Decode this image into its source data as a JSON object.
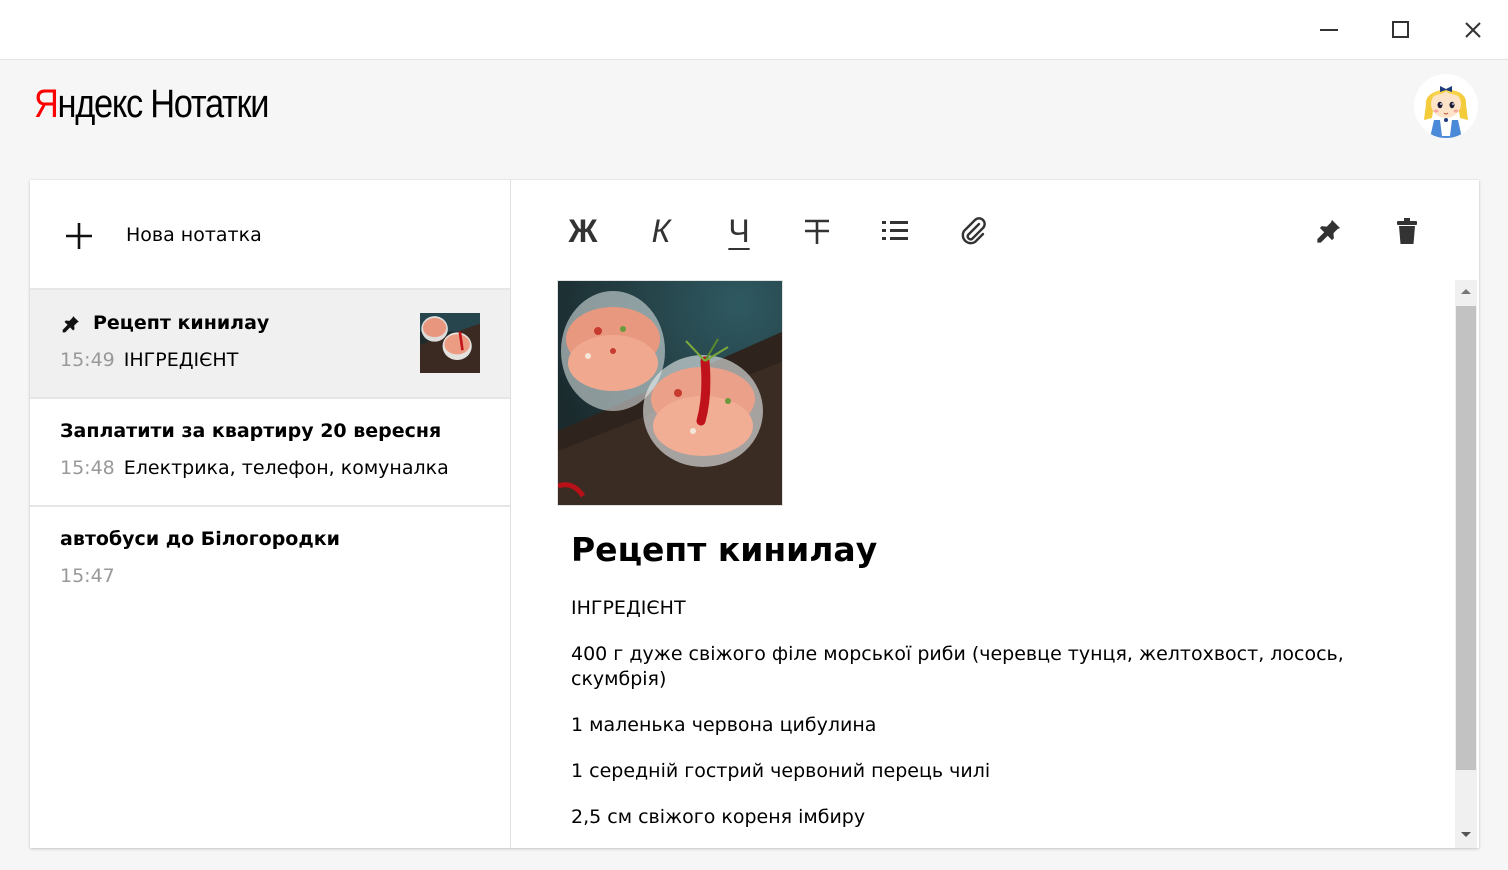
{
  "window": {
    "minimize_icon": "minimize-icon",
    "maximize_icon": "maximize-icon",
    "close_icon": "close-icon"
  },
  "header": {
    "logo_brand": "Яндекс",
    "logo_brand_first": "Я",
    "logo_brand_rest": "ндекс",
    "logo_product": "Нотатки",
    "brand_color": "#ff0000",
    "avatar_icon": "avatar-girl-icon"
  },
  "sidebar": {
    "new_note_label": "Нова нотатка",
    "new_note_icon": "plus-icon",
    "notes": [
      {
        "title": "Рецепт кинилау",
        "time": "15:49",
        "preview": "ІНГРЕДІЄНТ",
        "pinned": true,
        "has_thumbnail": true,
        "active": true
      },
      {
        "title": "Заплатити за квартиру 20 вересня",
        "time": "15:48",
        "preview": "Електрика, телефон, комуналка",
        "pinned": false,
        "has_thumbnail": false,
        "active": false
      },
      {
        "title": "автобуси до Білогородки",
        "time": "15:47",
        "preview": "",
        "pinned": false,
        "has_thumbnail": false,
        "active": false
      }
    ]
  },
  "toolbar": {
    "bold_label": "Ж",
    "italic_label": "К",
    "underline_label": "Ч",
    "strike_icon": "strikethrough-icon",
    "list_icon": "bullet-list-icon",
    "attach_icon": "paperclip-icon",
    "pin_icon": "pin-icon",
    "delete_icon": "trash-icon"
  },
  "editor": {
    "heading": "Рецепт кинилау",
    "paragraphs": [
      "ІНГРЕДІЄНТ",
      "400 г дуже свіжого філе морської риби (черевце тунця, желтохвост, лосось, скумбрія)",
      "1 маленька червона цибулина",
      "1 середній гострий червоний перець чилі",
      "2,5 см свіжого кореня імбиру"
    ]
  },
  "colors": {
    "time_gray": "#999999",
    "active_row": "#f0f0f0",
    "background": "#f6f6f6"
  }
}
